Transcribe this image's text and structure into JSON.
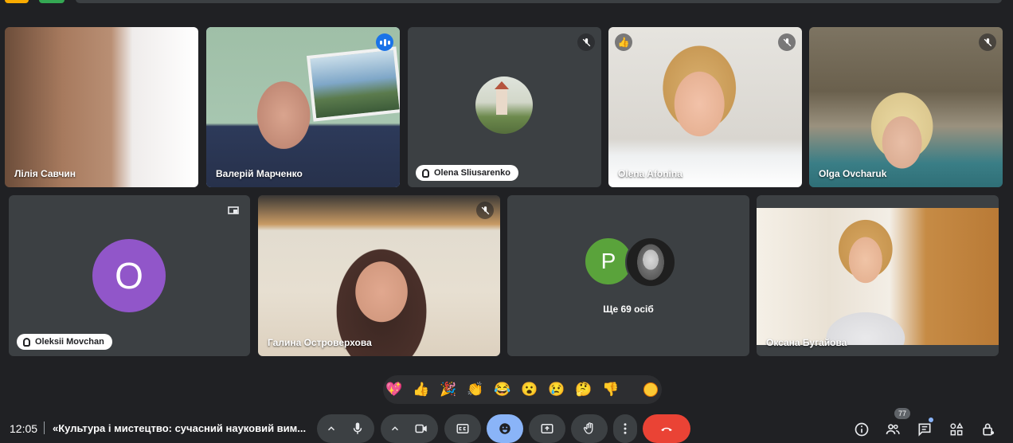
{
  "participants": [
    {
      "name": "Лілія Савчин"
    },
    {
      "name": "Валерій Марченко"
    },
    {
      "name": "Olena Sliusarenko"
    },
    {
      "name": "Olena Afonina"
    },
    {
      "name": "Olga Ovcharuk"
    },
    {
      "name": "Oleksii Movchan",
      "avatar_letter": "O"
    },
    {
      "name": "Галина Островерхова"
    },
    {
      "name": "Оксана Бугайова"
    }
  ],
  "overflow_tile": {
    "avatar_letter": "P",
    "label": "Ще 69 осіб"
  },
  "reactions": [
    "💖",
    "👍",
    "🎉",
    "👏",
    "😂",
    "😮",
    "😢",
    "🤔",
    "👎"
  ],
  "raised_reaction": "👍",
  "bottom_bar": {
    "time": "12:05",
    "meeting_title": "«Культура і мистецтво: сучасний науковий вим...",
    "participant_count": "77"
  },
  "colors": {
    "background": "#202124",
    "tile": "#3c4043",
    "accent": "#8ab4f8",
    "hangup": "#ea4335",
    "avatar_o": "#9156c9",
    "avatar_p": "#5aa33b"
  }
}
